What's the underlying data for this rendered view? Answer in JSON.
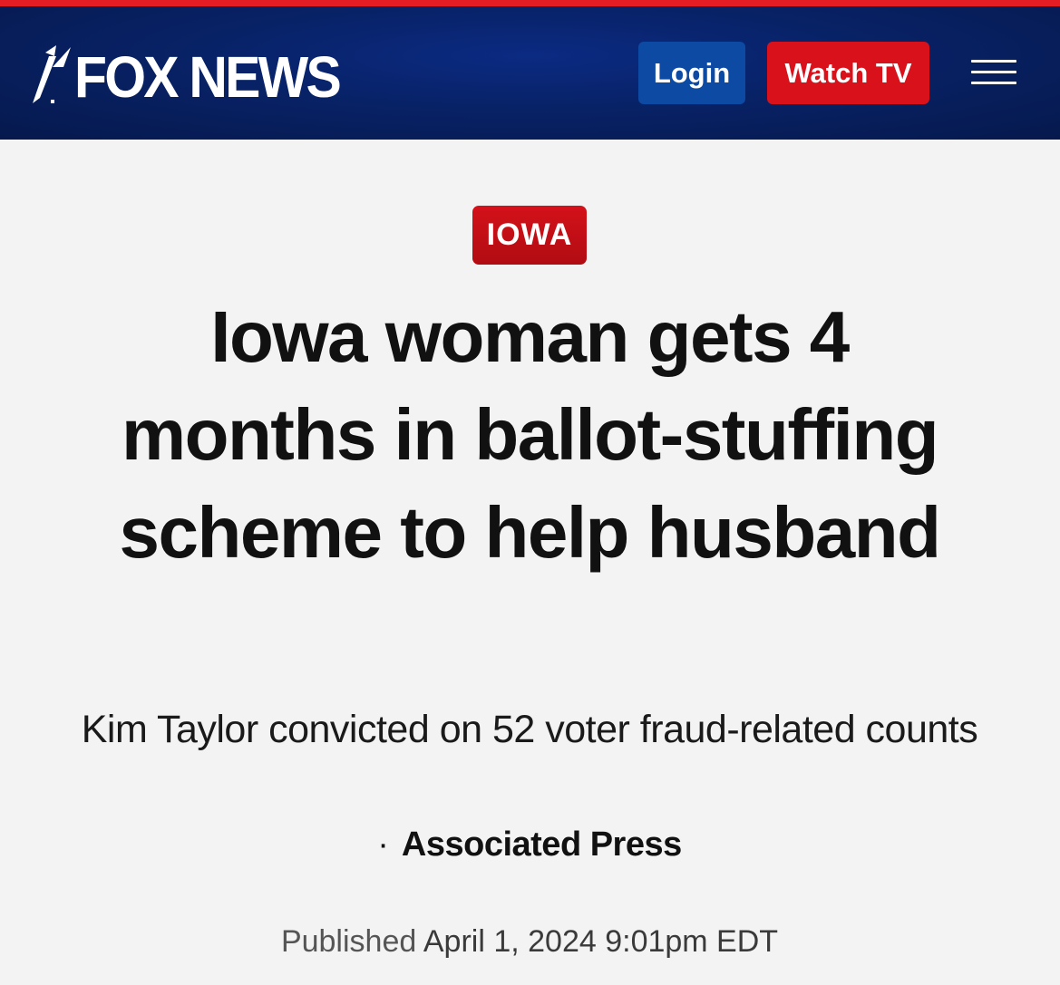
{
  "header": {
    "logo_text": "FOX NEWS",
    "login_label": "Login",
    "watch_label": "Watch TV",
    "menu_icon": "hamburger-menu-icon",
    "colors": {
      "nav_background": "#082266",
      "top_stripe": "#e41c23",
      "login_button": "#0d4aa3",
      "watch_button": "#d8111b"
    }
  },
  "article": {
    "category": "IOWA",
    "category_color": "#c20e16",
    "headline": "Iowa woman gets 4 months in ballot-stuffing scheme to help husband",
    "subheadline": "Kim Taylor convicted on 52 voter fraud-related counts",
    "byline_separator": "·",
    "byline_author": "Associated Press",
    "published_label": "Published",
    "published_date": "April 1, 2024 9:01pm EDT"
  }
}
